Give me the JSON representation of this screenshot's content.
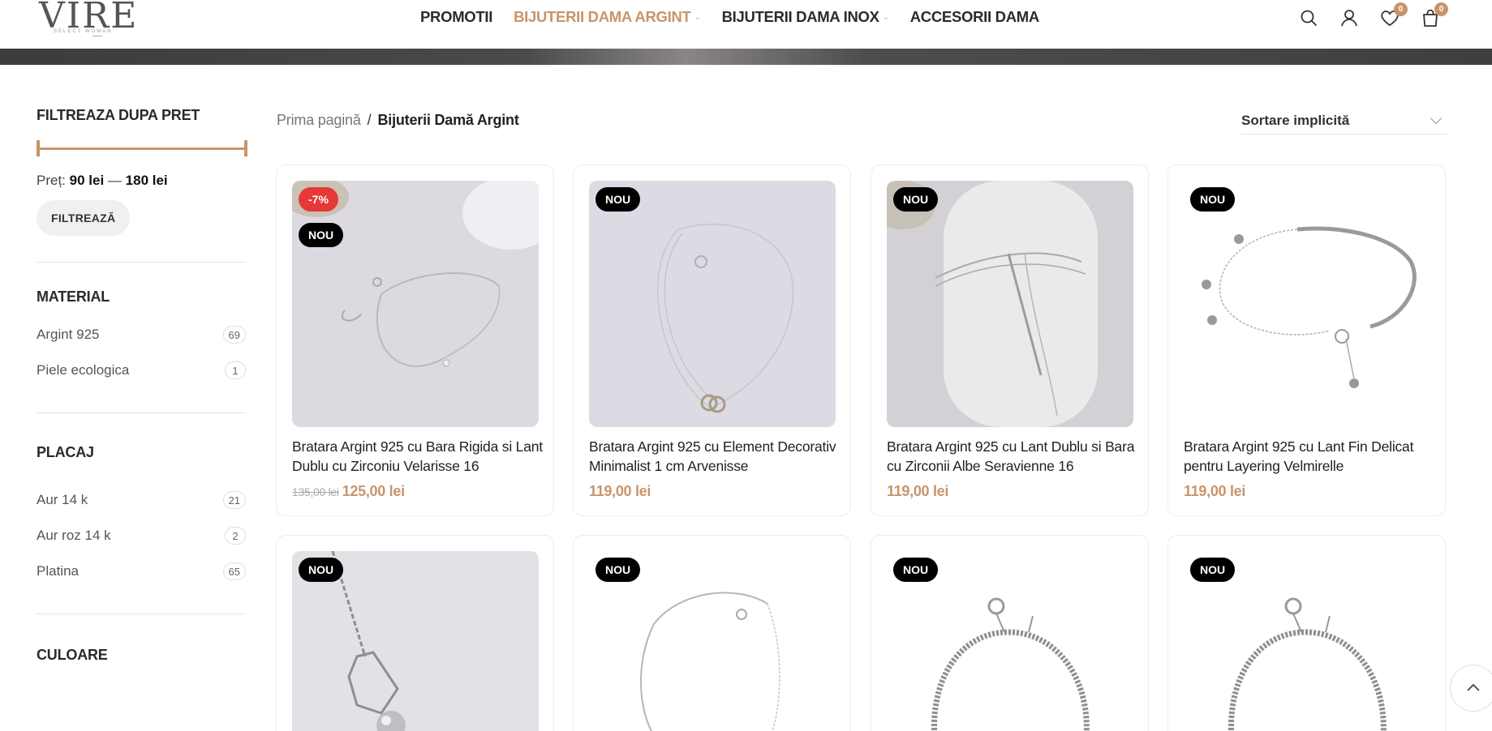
{
  "brand": {
    "logo_text": "VIRE",
    "logo_tagline": "SELECT WOMAN"
  },
  "nav": {
    "items": [
      {
        "label": "PROMOTII",
        "active": false,
        "dropdown": false
      },
      {
        "label": "BIJUTERII DAMA ARGINT",
        "active": true,
        "dropdown": true
      },
      {
        "label": "BIJUTERII DAMA INOX",
        "active": false,
        "dropdown": true
      },
      {
        "label": "ACCESORII DAMA",
        "active": false,
        "dropdown": false
      }
    ]
  },
  "header_icons": {
    "wishlist_count": "0",
    "cart_count": "0"
  },
  "colors": {
    "accent": "#c8946a",
    "sale_badge": "#e53935",
    "new_badge": "#000000"
  },
  "sidebar": {
    "price_filter": {
      "title": "FILTREAZA DUPA PRET",
      "label": "Preț:",
      "min": "90 lei",
      "dash": "—",
      "max": "180 lei",
      "button": "FILTREAZĂ"
    },
    "material": {
      "title": "MATERIAL",
      "items": [
        {
          "label": "Argint 925",
          "count": "69"
        },
        {
          "label": "Piele ecologica",
          "count": "1"
        }
      ]
    },
    "placaj": {
      "title": "PLACAJ",
      "items": [
        {
          "label": "Aur 14 k",
          "count": "21"
        },
        {
          "label": "Aur roz 14 k",
          "count": "2"
        },
        {
          "label": "Platina",
          "count": "65"
        }
      ]
    },
    "culoare": {
      "title": "CULOARE"
    }
  },
  "breadcrumb": {
    "home": "Prima pagină",
    "separator": "/",
    "current": "Bijuterii Damă Argint"
  },
  "sorting": {
    "selected": "Sortare implicită"
  },
  "products": [
    {
      "badges": [
        "-7%",
        "NOU"
      ],
      "title": "Bratara Argint 925 cu Bara Rigida si Lant Dublu cu Zirconiu Velarisse 16",
      "old_price": "135,00 lei",
      "price": "125,00 lei"
    },
    {
      "badges": [
        "NOU"
      ],
      "title": "Bratara Argint 925 cu Element Decorativ Minimalist 1 cm Arvenisse",
      "price": "119,00 lei"
    },
    {
      "badges": [
        "NOU"
      ],
      "title": "Bratara Argint 925 cu Lant Dublu si Bara cu Zirconii Albe Seravienne 16",
      "price": "119,00 lei"
    },
    {
      "badges": [
        "NOU"
      ],
      "title": "Bratara Argint 925 cu Lant Fin Delicat pentru Layering Velmirelle",
      "price": "119,00 lei"
    },
    {
      "badges": [
        "NOU"
      ]
    },
    {
      "badges": [
        "NOU"
      ]
    },
    {
      "badges": [
        "NOU"
      ]
    },
    {
      "badges": [
        "NOU"
      ]
    }
  ]
}
